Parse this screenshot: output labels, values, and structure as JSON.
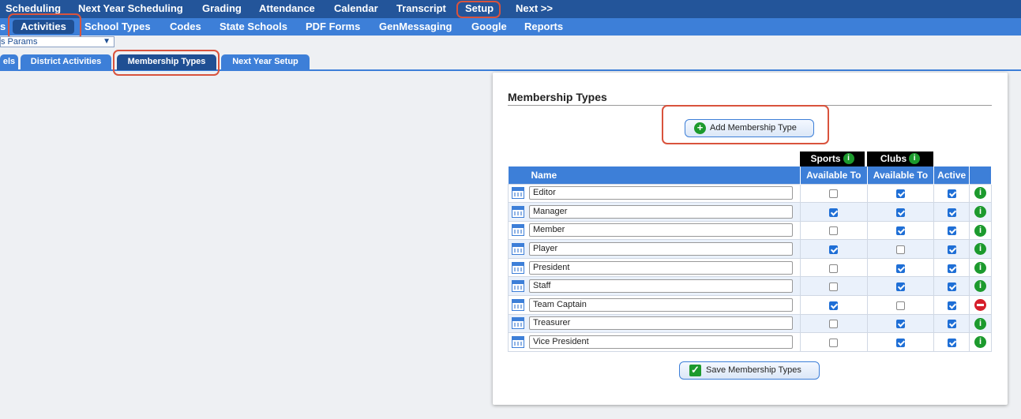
{
  "top_menu": [
    "Scheduling",
    "Next Year Scheduling",
    "Grading",
    "Attendance",
    "Calendar",
    "Transcript",
    "Setup",
    "Next >>"
  ],
  "sub_menu": [
    "s",
    "Activities",
    "School Types",
    "Codes",
    "State Schools",
    "PDF Forms",
    "GenMessaging",
    "Google",
    "Reports"
  ],
  "select_value": "s Params",
  "tabs": [
    "els",
    "District Activities",
    "Membership Types",
    "Next Year Setup"
  ],
  "panel": {
    "title": "Membership Types",
    "add_button": "Add Membership Type",
    "save_button": "Save Membership Types",
    "group_sports": "Sports",
    "group_clubs": "Clubs",
    "col_name": "Name",
    "col_sports": "Available To",
    "col_clubs": "Available To",
    "col_active": "Active"
  },
  "rows": [
    {
      "name": "Editor",
      "sports": false,
      "clubs": true,
      "active": true,
      "status": "info"
    },
    {
      "name": "Manager",
      "sports": true,
      "clubs": true,
      "active": true,
      "status": "info"
    },
    {
      "name": "Member",
      "sports": false,
      "clubs": true,
      "active": true,
      "status": "info"
    },
    {
      "name": "Player",
      "sports": true,
      "clubs": false,
      "active": true,
      "status": "info"
    },
    {
      "name": "President",
      "sports": false,
      "clubs": true,
      "active": true,
      "status": "info"
    },
    {
      "name": "Staff",
      "sports": false,
      "clubs": true,
      "active": true,
      "status": "info"
    },
    {
      "name": "Team Captain",
      "sports": true,
      "clubs": false,
      "active": true,
      "status": "delete"
    },
    {
      "name": "Treasurer",
      "sports": false,
      "clubs": true,
      "active": true,
      "status": "info"
    },
    {
      "name": "Vice President",
      "sports": false,
      "clubs": true,
      "active": true,
      "status": "info"
    }
  ],
  "colors": {
    "top_bar": "#23559a",
    "sub_bar": "#3d7fd8",
    "highlight": "#d9533d",
    "info_green": "#1c9a2d",
    "delete_red": "#d61f2b"
  }
}
